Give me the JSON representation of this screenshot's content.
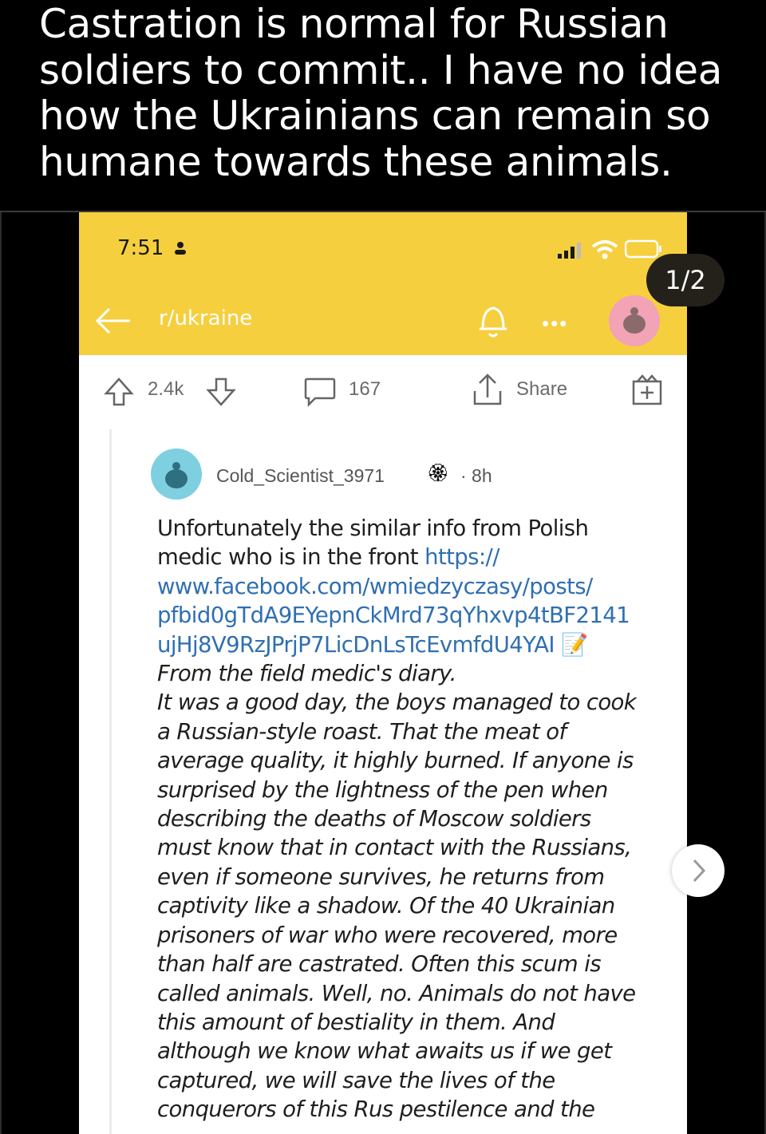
{
  "caption": {
    "lines": [
      "Castration is normal for Russian",
      "soldiers to commit.. I have no idea",
      "how the Ukrainians can remain so",
      "humane towards these animals."
    ]
  },
  "screenshot": {
    "status_bar": {
      "time": "7:51"
    },
    "header": {
      "subreddit": "r/ukraine",
      "more_label": "•••"
    },
    "actions": {
      "score": "2.4k",
      "comments": "167",
      "share": "Share"
    },
    "comment": {
      "username": "Cold_Scientist_3971",
      "time": "· 8h",
      "lines": [
        "Unfortunately the similar info from Polish",
        "medic who is in the front ",
        "www.facebook.com/wmiedzyczasy/posts/",
        "pfbid0gTdA9EYepnCkMrd73qYhxvp4tBF2141",
        "ujHj8V9RzJPrjP7LicDnLsTcEvmfdU4YAI",
        "From the field medic's diary.",
        "It was a good day, the boys managed to cook",
        "a Russian-style roast. That the meat of",
        "average quality, it highly burned. If anyone is",
        "surprised by the lightness of the pen when",
        "describing the deaths of Moscow soldiers",
        "must know that in contact with the Russians,",
        "even if someone survives, he returns from",
        "captivity like a shadow. Of the 40 Ukrainian",
        "prisoners of war who were recovered, more",
        "than half are castrated. Often this scum is",
        "called animals. Well, no. Animals do not have",
        "this amount of bestiality in them. And",
        "although we know what awaits us if we get",
        "captured, we will save the lives of the",
        "conquerors of this Rus pestilence and the"
      ],
      "link_prefix": "https://"
    }
  },
  "gallery": {
    "counter": "1/2"
  },
  "colors": {
    "header_yellow": "#f6cf3f",
    "link_blue": "#2f6fb2"
  }
}
